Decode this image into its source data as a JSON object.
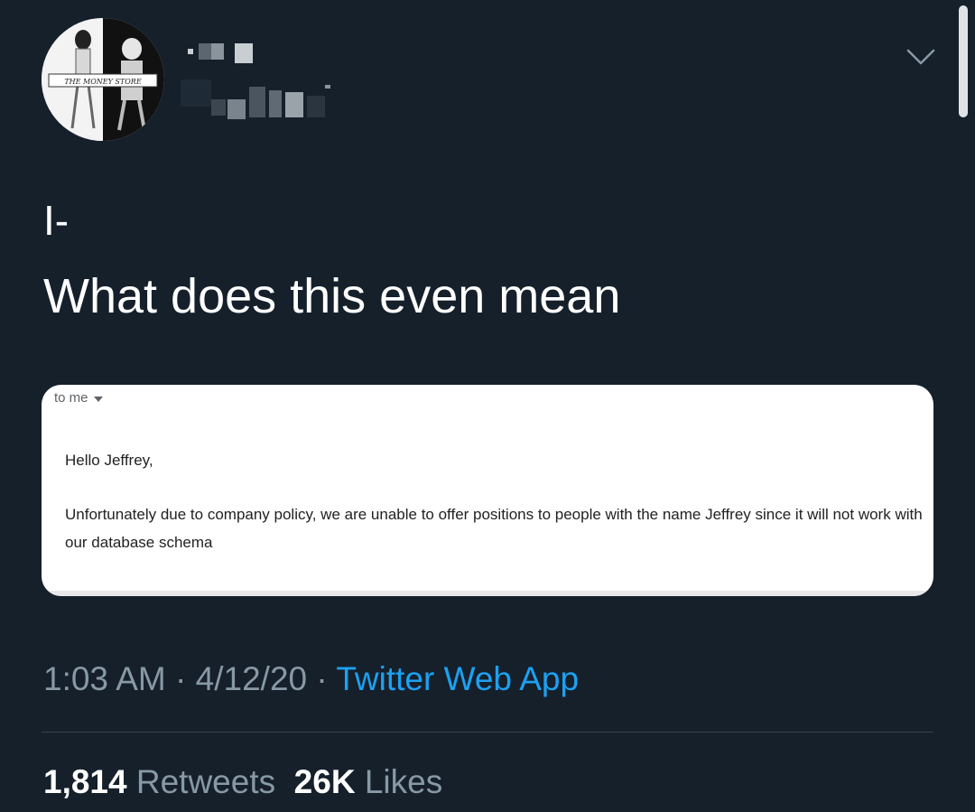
{
  "avatar": {
    "caption": "THE MONEY STORE"
  },
  "header": {
    "menu_icon": "chevron-down-icon"
  },
  "tweet": {
    "line1": "I-",
    "line2": "What does this even mean"
  },
  "email": {
    "recipient_label": "to me",
    "greeting": "Hello Jeffrey,",
    "body": "Unfortunately due to company policy, we are unable to offer positions to people with the name Jeffrey since it will not work with our database schema"
  },
  "meta": {
    "time": "1:03 AM",
    "separator": " · ",
    "date": "4/12/20",
    "source": "Twitter Web App"
  },
  "stats": {
    "retweets_count": "1,814",
    "retweets_label": "Retweets",
    "likes_count": "26K",
    "likes_label": "Likes"
  },
  "colors": {
    "background": "#15202b",
    "link": "#1da1f2",
    "muted": "#8899a6"
  }
}
